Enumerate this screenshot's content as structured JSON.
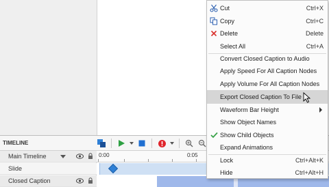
{
  "timeline": {
    "title": "TIMELINE",
    "rows": [
      {
        "label": "Main Timeline"
      },
      {
        "label": "Slide"
      },
      {
        "label": "Closed Caption"
      }
    ],
    "ruler": {
      "start": "0:00",
      "mark": "0:05"
    }
  },
  "context_menu": {
    "items": [
      {
        "label": "Cut",
        "shortcut": "Ctrl+X",
        "icon": "scissors-icon"
      },
      {
        "label": "Copy",
        "shortcut": "Ctrl+C",
        "icon": "copy-icon"
      },
      {
        "label": "Delete",
        "shortcut": "Delete",
        "icon": "delete-x-icon"
      },
      {
        "label": "Select All",
        "shortcut": "Ctrl+A"
      },
      {
        "label": "Convert Closed Caption to Audio",
        "shortcut": ""
      },
      {
        "label": "Apply Speed For All Caption Nodes",
        "shortcut": ""
      },
      {
        "label": "Apply Volume For All Caption Nodes",
        "shortcut": ""
      },
      {
        "label": "Export Closed Caption To File",
        "shortcut": "",
        "highlighted": true
      },
      {
        "label": "Waveform Bar Height",
        "shortcut": "",
        "submenu": true
      },
      {
        "label": "Show Object Names",
        "shortcut": ""
      },
      {
        "label": "Show Child Objects",
        "shortcut": "",
        "checked": true
      },
      {
        "label": "Expand Animations",
        "shortcut": ""
      },
      {
        "label": "Lock",
        "shortcut": "Ctrl+Alt+K"
      },
      {
        "label": "Hide",
        "shortcut": "Ctrl+Alt+H"
      }
    ]
  },
  "colors": {
    "accent_blue": "#2f80d6",
    "play_green": "#2ea043",
    "stop_blue": "#1f6fd1",
    "record_red": "#e0252b",
    "check_green": "#3aa34a",
    "delete_red": "#d9302c",
    "menu_highlight": "#d6d6d6"
  }
}
